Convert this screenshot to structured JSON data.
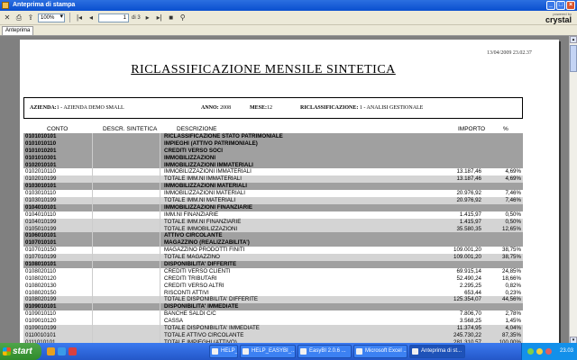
{
  "window": {
    "title": "Anteprima di stampa"
  },
  "toolbar": {
    "zoom": "100%",
    "current_page": "1",
    "page_total": "di 3"
  },
  "logo": {
    "powered_by": "powered by",
    "brand": "crystal"
  },
  "tabs": [
    {
      "label": "Anteprima"
    }
  ],
  "report": {
    "date": "13/04/2009  23.02.37",
    "title": "RICLASSIFICAZIONE MENSILE SINTETICA",
    "azienda_label": "AZIENDA:",
    "azienda_value": "1 - AZIENDA DEMO SMALL",
    "anno_label": "ANNO:",
    "anno_value": "2008",
    "mese_label": "MESE:",
    "mese_value": "12",
    "riclass_label": "RICLASSIFICAZIONE:",
    "riclass_value": "1 - ANALISI GESTIONALE",
    "columns": {
      "conto": "CONTO",
      "sintetica": "DESCR. SINTETICA",
      "descrizione": "DESCRIZIONE",
      "importo": "IMPORTO",
      "perc": "%"
    },
    "rows": [
      {
        "conto": "0101010101",
        "desc": "RICLASSIFICAZIONE STATO PATRIMONIALE",
        "importo": "",
        "perc": "",
        "style": "dark"
      },
      {
        "conto": "0101010110",
        "desc": "IMPIEGHI (ATTIVO PATRIMONIALE)",
        "importo": "",
        "perc": "",
        "style": "dark"
      },
      {
        "conto": "0101010201",
        "desc": "CREDITI VERSO SOCI",
        "importo": "",
        "perc": "",
        "style": "dark"
      },
      {
        "conto": "0101010301",
        "desc": "IMMOBILIZZAZIONI",
        "importo": "",
        "perc": "",
        "style": "dark"
      },
      {
        "conto": "0102010101",
        "desc": "IMMOBILIZZAZIONI IMMATERIALI",
        "importo": "",
        "perc": "",
        "style": "dark"
      },
      {
        "conto": "0102010110",
        "desc": "IMMOBILIZZAZIONI IMMATERIALI",
        "importo": "13.187,46",
        "perc": "4,69%",
        "style": "white"
      },
      {
        "conto": "0102010199",
        "desc": "TOTALE IMM.NI IMMATERIALI",
        "importo": "13.187,46",
        "perc": "4,69%",
        "style": "light"
      },
      {
        "conto": "0103010101",
        "desc": "IMMOBILIZZAZIONI MATERIALI",
        "importo": "",
        "perc": "",
        "style": "dark"
      },
      {
        "conto": "0103010110",
        "desc": "IMMOBILIZZAZIONI MATERIALI",
        "importo": "20.976,92",
        "perc": "7,46%",
        "style": "white"
      },
      {
        "conto": "0103010199",
        "desc": "TOTALE IMM.NI MATERIALI",
        "importo": "20.976,92",
        "perc": "7,46%",
        "style": "light"
      },
      {
        "conto": "0104010101",
        "desc": "IMMOBILIZZAZIONI FINANZIARIE",
        "importo": "",
        "perc": "",
        "style": "dark"
      },
      {
        "conto": "0104010110",
        "desc": "IMM.NI FINANZIARIE",
        "importo": "1.415,97",
        "perc": "0,50%",
        "style": "white"
      },
      {
        "conto": "0104010199",
        "desc": "TOTALE IMM.NI FINANZIARIE",
        "importo": "1.415,97",
        "perc": "0,50%",
        "style": "light"
      },
      {
        "conto": "0105010199",
        "desc": "TOTALE IMMOBILIZZAZIONI",
        "importo": "35.580,35",
        "perc": "12,65%",
        "style": "light"
      },
      {
        "conto": "0106010101",
        "desc": "ATTIVO CIRCOLANTE",
        "importo": "",
        "perc": "",
        "style": "dark"
      },
      {
        "conto": "0107010101",
        "desc": "MAGAZZINO (REALIZZABILITA')",
        "importo": "",
        "perc": "",
        "style": "dark"
      },
      {
        "conto": "0107010150",
        "desc": "MAGAZZINO PRODOTTI FINITI",
        "importo": "109.001,20",
        "perc": "38,75%",
        "style": "white"
      },
      {
        "conto": "0107010199",
        "desc": "TOTALE MAGAZZINO",
        "importo": "109.001,20",
        "perc": "38,75%",
        "style": "light"
      },
      {
        "conto": "0108010101",
        "desc": "DISPONIBILITA' DIFFERITE",
        "importo": "",
        "perc": "",
        "style": "dark"
      },
      {
        "conto": "0108020110",
        "desc": "CREDITI VERSO CLIENTI",
        "importo": "69.915,14",
        "perc": "24,85%",
        "style": "white"
      },
      {
        "conto": "0108020120",
        "desc": "CREDITI TRIBUTARI",
        "importo": "52.490,24",
        "perc": "18,66%",
        "style": "white"
      },
      {
        "conto": "0108020130",
        "desc": "CREDITI VERSO ALTRI",
        "importo": "2.295,25",
        "perc": "0,82%",
        "style": "white"
      },
      {
        "conto": "0108020150",
        "desc": "RISCONTI ATTIVI",
        "importo": "653,44",
        "perc": "0,23%",
        "style": "white"
      },
      {
        "conto": "0108020199",
        "desc": "TOTALE DISPONIBILITA' DIFFERITE",
        "importo": "125.354,07",
        "perc": "44,56%",
        "style": "light"
      },
      {
        "conto": "0109010101",
        "desc": "DISPONIBILITA' IMMEDIATE",
        "importo": "",
        "perc": "",
        "style": "dark"
      },
      {
        "conto": "0109010110",
        "desc": "BANCHE SALDI C/C",
        "importo": "7.806,70",
        "perc": "2,78%",
        "style": "white"
      },
      {
        "conto": "0109010120",
        "desc": "CASSA",
        "importo": "3.568,25",
        "perc": "1,45%",
        "style": "white"
      },
      {
        "conto": "0109010199",
        "desc": "TOTALE DISPONIBILITA' IMMEDIATE",
        "importo": "11.374,95",
        "perc": "4,04%",
        "style": "light"
      },
      {
        "conto": "0110010101",
        "desc": "TOTALE ATTIVO CIRCOLANTE",
        "importo": "245.730,22",
        "perc": "87,35%",
        "style": "light"
      },
      {
        "conto": "0111010101",
        "desc": "TOTALE IMPIEGHI (ATTIVO)",
        "importo": "281.310,57",
        "perc": "100,00%",
        "style": "light"
      }
    ]
  },
  "taskbar": {
    "start_label": "start",
    "tasks": [
      {
        "label": "HELP_EASYBI..."
      },
      {
        "label": "HELP_EASYBI_..."
      },
      {
        "label": "EasyBI   2.0.6 ..."
      },
      {
        "label": "Microsoft Excel ..."
      },
      {
        "label": "Anteprima di st..."
      }
    ],
    "clock": "23.03"
  }
}
